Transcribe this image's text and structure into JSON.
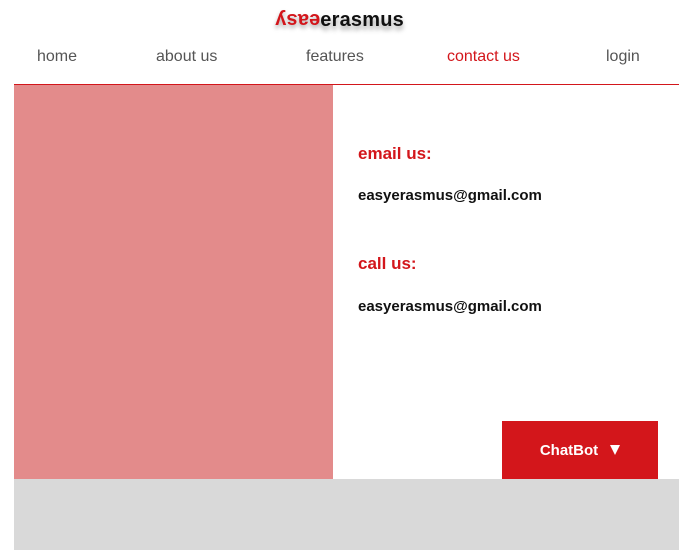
{
  "logo": {
    "part1": "easy",
    "part2": "erasmus"
  },
  "nav": {
    "items": [
      {
        "label": "home",
        "active": false
      },
      {
        "label": "about us",
        "active": false
      },
      {
        "label": "features",
        "active": false
      },
      {
        "label": "contact us",
        "active": true
      },
      {
        "label": "login",
        "active": false
      }
    ]
  },
  "contact": {
    "email_heading": "email us:",
    "email_value": "easyerasmus@gmail.com",
    "call_heading": "call us:",
    "call_value": "easyerasmus@gmail.com"
  },
  "chatbot": {
    "label": "ChatBot",
    "icon": "caret-down-icon"
  },
  "colors": {
    "accent": "#d3161b",
    "image_placeholder": "#e38b8b",
    "footer": "#d9d9d9",
    "nav_text": "#555555"
  }
}
